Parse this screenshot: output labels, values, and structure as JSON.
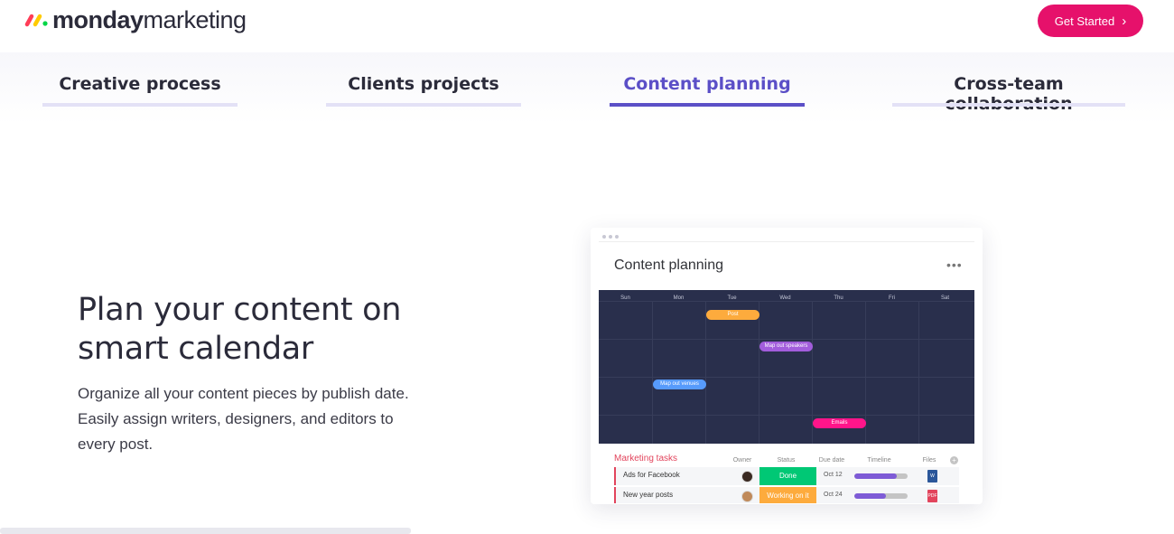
{
  "header": {
    "logo_bold": "monday",
    "logo_light": "marketing",
    "cta_label": "Get Started",
    "cta_icon": "chevron-right-icon"
  },
  "tabs": [
    {
      "label": "Creative process",
      "active": false
    },
    {
      "label": "Clients projects",
      "active": false
    },
    {
      "label": "Content planning",
      "active": true
    },
    {
      "label": "Cross-team collaboration",
      "active": false
    }
  ],
  "hero": {
    "headline_line1": "Plan your content on",
    "headline_line2": "smart calendar",
    "description_line1": "Organize all your content pieces by publish date.",
    "description_line2": "Easily assign writers, designers, and editors to",
    "description_line3": "every post."
  },
  "mockup": {
    "title": "Content planning",
    "more_icon": "ellipsis-icon",
    "calendar": {
      "days": [
        "Sun",
        "Mon",
        "Tue",
        "Wed",
        "Thu",
        "Fri",
        "Sat"
      ],
      "events": [
        {
          "label": "Post",
          "color": "#fdab3d"
        },
        {
          "label": "Map out speakers",
          "color": "#a25ddc"
        },
        {
          "label": "Map out venues",
          "color": "#579bfc"
        },
        {
          "label": "Emails",
          "color": "#ff158a"
        }
      ]
    },
    "tasks": {
      "title": "Marketing tasks",
      "columns": [
        "Owner",
        "Status",
        "Due date",
        "Timeline",
        "Files"
      ],
      "rows": [
        {
          "name": "Ads for Facebook",
          "status": "Done",
          "status_color": "#00c875",
          "due": "Oct 12",
          "timeline_progress": 0.8,
          "file_color": "#2b579a"
        },
        {
          "name": "New year posts",
          "status": "Working on it",
          "status_color": "#fdab3d",
          "due": "Oct 24",
          "timeline_progress": 0.6,
          "file_color": "#e2445c"
        }
      ]
    }
  },
  "colors": {
    "brand_pink": "#e6116b",
    "tab_active": "#5b4fc7",
    "calendar_bg": "#292f4c"
  }
}
